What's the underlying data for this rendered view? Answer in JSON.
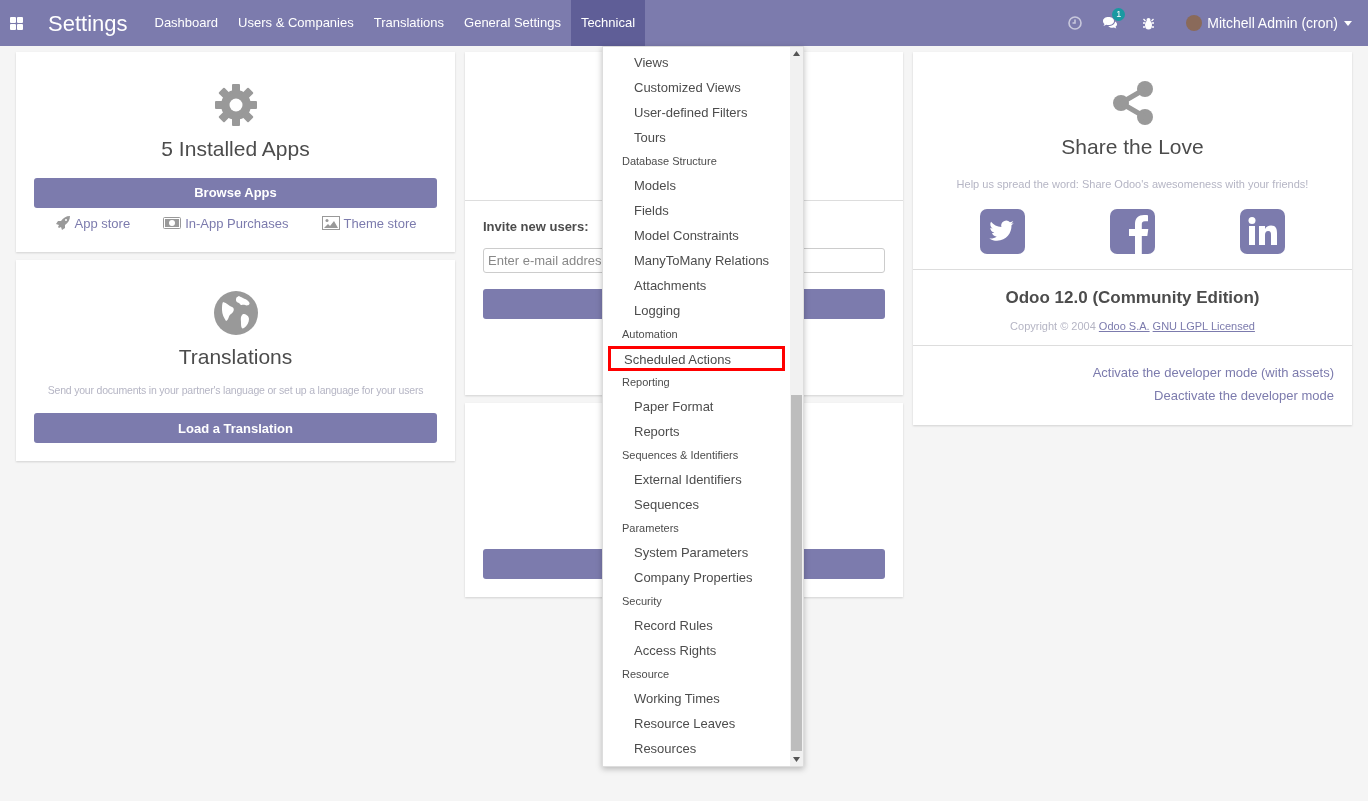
{
  "navbar": {
    "app_title": "Settings",
    "menu": [
      {
        "label": "Dashboard",
        "selected": false
      },
      {
        "label": "Users & Companies",
        "selected": false
      },
      {
        "label": "Translations",
        "selected": false
      },
      {
        "label": "General Settings",
        "selected": false
      },
      {
        "label": "Technical",
        "selected": true
      }
    ],
    "messages_badge": "1",
    "user": "Mitchell Admin (cron)"
  },
  "apps_card": {
    "title": "5 Installed Apps",
    "button": "Browse Apps",
    "links": [
      "App store",
      "In-App Purchases",
      "Theme store"
    ]
  },
  "translations_card": {
    "title": "Translations",
    "description": "Send your documents in your partner's language or set up a language for your users",
    "button": "Load a Translation"
  },
  "users_card": {
    "invite_label": "Invite new users:",
    "placeholder": "Enter e-mail addres"
  },
  "share_card": {
    "title": "Share the Love",
    "description": "Help us spread the word: Share Odoo's awesomeness with your friends!",
    "version": "Odoo 12.0 (Community Edition)",
    "copyright": "Copyright © 2004",
    "company_link": "Odoo S.A.",
    "license_link": "GNU LGPL Licensed",
    "developer_links": [
      "Activate the developer mode (with assets)",
      "Deactivate the developer mode"
    ]
  },
  "technical_menu": [
    {
      "kind": "item",
      "label": "Views",
      "highlighted": false
    },
    {
      "kind": "item",
      "label": "Customized Views",
      "highlighted": false
    },
    {
      "kind": "item",
      "label": "User-defined Filters",
      "highlighted": false
    },
    {
      "kind": "item",
      "label": "Tours",
      "highlighted": false
    },
    {
      "kind": "header",
      "label": "Database Structure"
    },
    {
      "kind": "item",
      "label": "Models",
      "highlighted": false
    },
    {
      "kind": "item",
      "label": "Fields",
      "highlighted": false
    },
    {
      "kind": "item",
      "label": "Model Constraints",
      "highlighted": false
    },
    {
      "kind": "item",
      "label": "ManyToMany Relations",
      "highlighted": false
    },
    {
      "kind": "item",
      "label": "Attachments",
      "highlighted": false
    },
    {
      "kind": "item",
      "label": "Logging",
      "highlighted": false
    },
    {
      "kind": "header",
      "label": "Automation"
    },
    {
      "kind": "item",
      "label": "Scheduled Actions",
      "highlighted": true
    },
    {
      "kind": "header",
      "label": "Reporting"
    },
    {
      "kind": "item",
      "label": "Paper Format",
      "highlighted": false
    },
    {
      "kind": "item",
      "label": "Reports",
      "highlighted": false
    },
    {
      "kind": "header",
      "label": "Sequences & Identifiers"
    },
    {
      "kind": "item",
      "label": "External Identifiers",
      "highlighted": false
    },
    {
      "kind": "item",
      "label": "Sequences",
      "highlighted": false
    },
    {
      "kind": "header",
      "label": "Parameters"
    },
    {
      "kind": "item",
      "label": "System Parameters",
      "highlighted": false
    },
    {
      "kind": "item",
      "label": "Company Properties",
      "highlighted": false
    },
    {
      "kind": "header",
      "label": "Security"
    },
    {
      "kind": "item",
      "label": "Record Rules",
      "highlighted": false
    },
    {
      "kind": "item",
      "label": "Access Rights",
      "highlighted": false
    },
    {
      "kind": "header",
      "label": "Resource"
    },
    {
      "kind": "item",
      "label": "Working Times",
      "highlighted": false
    },
    {
      "kind": "item",
      "label": "Resource Leaves",
      "highlighted": false
    },
    {
      "kind": "item",
      "label": "Resources",
      "highlighted": false
    }
  ]
}
